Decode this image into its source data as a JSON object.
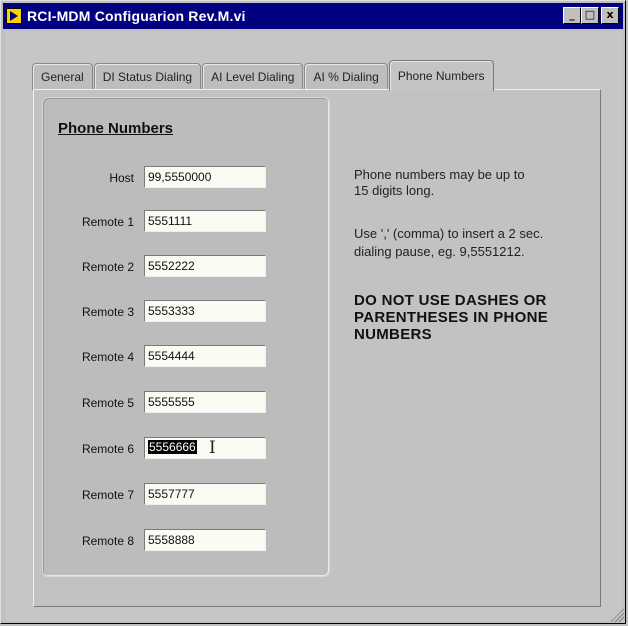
{
  "window": {
    "title": "RCI-MDM Configuarion Rev.M.vi",
    "buttons": {
      "minimize": "_",
      "maximize": "□",
      "close": "x"
    }
  },
  "tabs": [
    {
      "label": "General",
      "active": false
    },
    {
      "label": "DI Status Dialing",
      "active": false
    },
    {
      "label": "AI Level Dialing",
      "active": false
    },
    {
      "label": "AI % Dialing",
      "active": false
    },
    {
      "label": "Phone Numbers",
      "active": true
    }
  ],
  "group": {
    "title": "Phone Numbers",
    "fields": [
      {
        "label": "Host",
        "value": "99,5550000"
      },
      {
        "label": "Remote 1",
        "value": "5551111"
      },
      {
        "label": "Remote 2",
        "value": "5552222"
      },
      {
        "label": "Remote 3",
        "value": "5553333"
      },
      {
        "label": "Remote 4",
        "value": "5554444"
      },
      {
        "label": "Remote 5",
        "value": "5555555"
      },
      {
        "label": "Remote 6",
        "value": "5556666"
      },
      {
        "label": "Remote 7",
        "value": "5557777"
      },
      {
        "label": "Remote 8",
        "value": "5558888"
      }
    ]
  },
  "info": {
    "line1": "Phone numbers may be up to",
    "line2": "15 digits long.",
    "line3": "Use ',' (comma) to insert a 2 sec.",
    "line4": "dialing pause, eg. 9,5551212.",
    "warning_line1": "DO NOT USE DASHES OR",
    "warning_line2": "PARENTHESES IN PHONE",
    "warning_line3": "NUMBERS"
  },
  "colors": {
    "titlebar": "#000080",
    "field_bg": "#fbfbf3",
    "window_bg": "#c0c0c0"
  }
}
